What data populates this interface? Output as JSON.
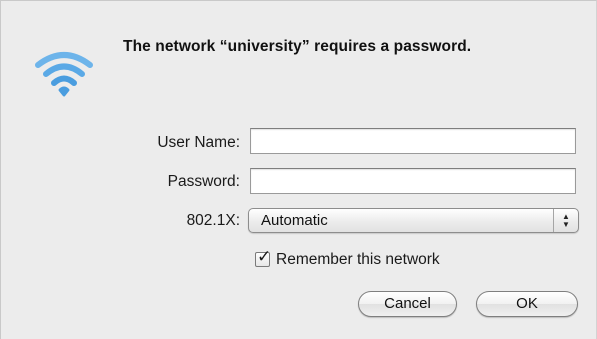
{
  "dialog": {
    "title": "The network “university” requires a password.",
    "icon": "wifi-icon",
    "icon_color": "#5aa9e6"
  },
  "form": {
    "username_label": "User Name:",
    "username_value": "",
    "password_label": "Password:",
    "password_value": "",
    "security_label": "802.1X:",
    "security_selected": "Automatic",
    "remember_checked": true,
    "remember_label": "Remember this network"
  },
  "buttons": {
    "cancel_label": "Cancel",
    "ok_label": "OK"
  }
}
